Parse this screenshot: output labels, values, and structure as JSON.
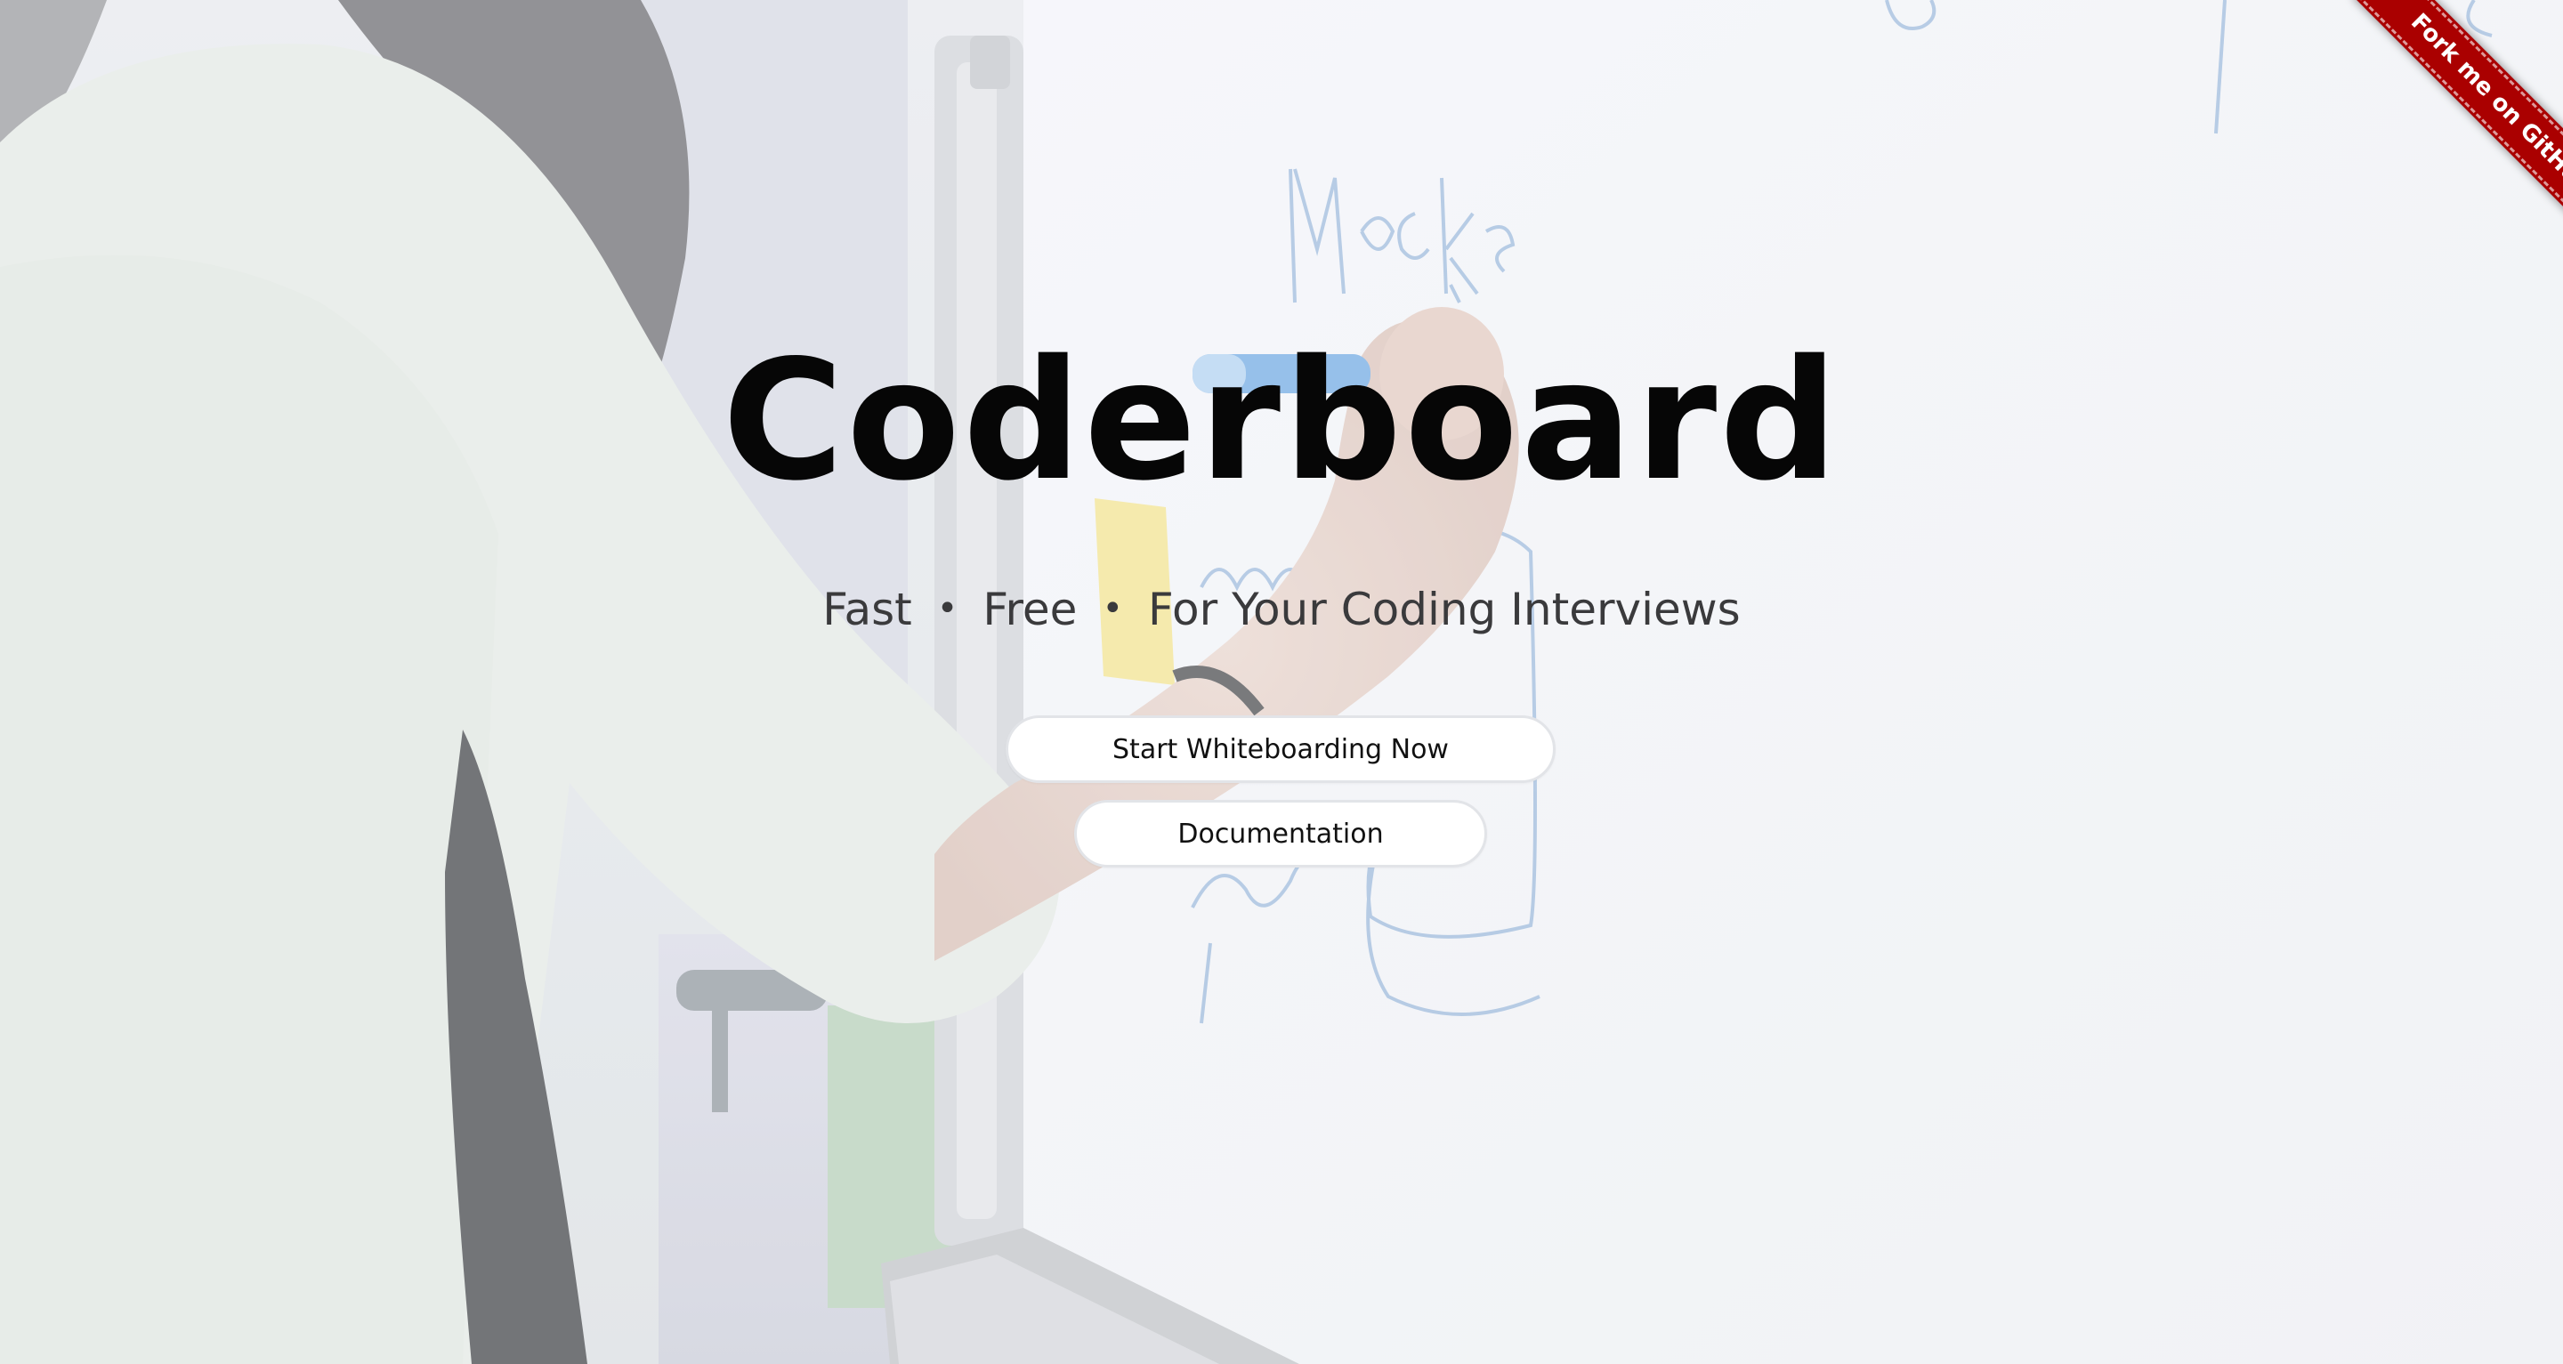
{
  "hero": {
    "title": "Coderboard",
    "tagline": {
      "part1": "Fast",
      "separator": "•",
      "part2": "Free",
      "part3": "For Your Coding Interviews"
    }
  },
  "buttons": {
    "start_label": "Start Whiteboarding Now",
    "docs_label": "Documentation"
  },
  "ribbon": {
    "label": "Fork me on GitHub",
    "color": "#aa0000"
  },
  "theme": {
    "title_color": "#060606",
    "tagline_color": "#3a3a3c",
    "button_bg": "#ffffff"
  }
}
